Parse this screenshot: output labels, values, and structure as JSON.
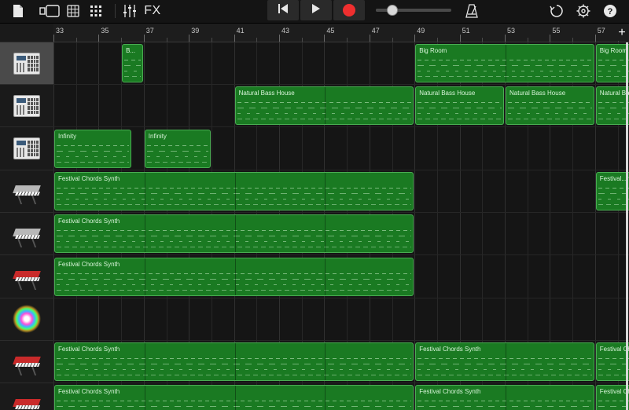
{
  "toolbar": {
    "buttons": {
      "browser": "document-icon",
      "view_toggle": "view-toggle-icon",
      "tracks_view": "grid-icon",
      "live_loops": "live-loops-icon",
      "mixer": "mixer-sliders-icon",
      "fx_label": "FX",
      "rewind": "rewind-icon",
      "play": "play-icon",
      "record": "record-icon",
      "metronome": "metronome-icon",
      "loop_browser": "loop-icon",
      "settings": "gear-icon",
      "help": "help-icon"
    },
    "master_volume": 0.22,
    "record_color": "#ef2f2f"
  },
  "ruler": {
    "labels": [
      "33",
      "35",
      "37",
      "39",
      "41",
      "43",
      "45",
      "47",
      "49",
      "51",
      "53",
      "55",
      "57"
    ],
    "add_label": "+"
  },
  "region_color": "#1a7a22",
  "region_border": "#49ad52",
  "tracks": [
    {
      "instrument": "drum-machine-icon",
      "selected": true,
      "regions": [
        {
          "name": "B...",
          "start": 36,
          "length": 1
        },
        {
          "name": "Big Room",
          "start": 49,
          "length": 8
        },
        {
          "name": "Big Room",
          "start": 57,
          "length": 2
        }
      ]
    },
    {
      "instrument": "drum-machine-icon",
      "selected": false,
      "regions": [
        {
          "name": "Natural Bass House",
          "start": 41,
          "length": 8
        },
        {
          "name": "Natural Bass House",
          "start": 49,
          "length": 4
        },
        {
          "name": "Natural Bass House",
          "start": 53,
          "length": 4
        },
        {
          "name": "Natural Bass House",
          "start": 57,
          "length": 2
        }
      ]
    },
    {
      "instrument": "drum-machine-icon",
      "selected": false,
      "regions": [
        {
          "name": "Infinity",
          "start": 33,
          "length": 3.5
        },
        {
          "name": "Infinity",
          "start": 37,
          "length": 3
        }
      ]
    },
    {
      "instrument": "silver-keyboard-icon",
      "selected": false,
      "regions": [
        {
          "name": "Festival Chords Synth",
          "start": 33,
          "length": 16
        },
        {
          "name": "Festival...rd...",
          "start": 57,
          "length": 2
        }
      ]
    },
    {
      "instrument": "silver-keyboard-icon",
      "selected": false,
      "regions": [
        {
          "name": "Festival Chords Synth",
          "start": 33,
          "length": 16
        }
      ]
    },
    {
      "instrument": "red-keyboard-icon",
      "selected": false,
      "regions": [
        {
          "name": "Festival Chords Synth",
          "start": 33,
          "length": 16
        }
      ]
    },
    {
      "instrument": "sparkle-sampler-icon",
      "selected": false,
      "regions": []
    },
    {
      "instrument": "red-keyboard-icon",
      "selected": false,
      "regions": [
        {
          "name": "Festival Chords Synth",
          "start": 33,
          "length": 16
        },
        {
          "name": "Festival Chords Synth",
          "start": 49,
          "length": 8
        },
        {
          "name": "Festival Ch",
          "start": 57,
          "length": 2
        }
      ]
    },
    {
      "instrument": "red-keyboard-icon",
      "selected": false,
      "regions": [
        {
          "name": "Festival Chords Synth",
          "start": 33,
          "length": 16
        },
        {
          "name": "Festival Chords Synth",
          "start": 49,
          "length": 8
        },
        {
          "name": "Festival Ch",
          "start": 57,
          "length": 2
        }
      ]
    }
  ]
}
